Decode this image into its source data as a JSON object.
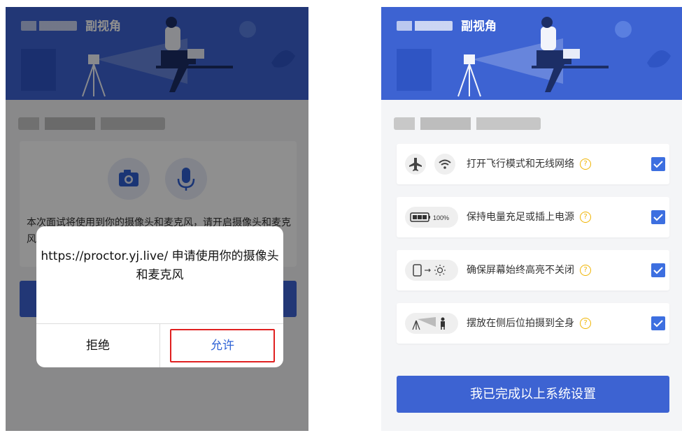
{
  "app": {
    "title": "副视角"
  },
  "camera_permission_screen": {
    "permission_text": "本次面试将使用到你的摄像头和麦克风，请开启摄像头和麦克风权限",
    "dialog": {
      "message": "https://proctor.yj.live/ 申请使用你的摄像头和麦克风",
      "deny_label": "拒绝",
      "allow_label": "允许"
    }
  },
  "setup_checklist": {
    "items": [
      {
        "label": "打开飞行模式和无线网络",
        "checked": true
      },
      {
        "label": "保持电量充足或插上电源",
        "checked": true,
        "battery_text": "100%"
      },
      {
        "label": "确保屏幕始终高亮不关闭",
        "checked": true
      },
      {
        "label": "摆放在侧后位拍摄到全身",
        "checked": true
      }
    ],
    "complete_button": "我已完成以上系统设置"
  },
  "colors": {
    "primary": "#3d63d2",
    "highlight_border": "#e02020",
    "help_icon": "#f0b400"
  }
}
